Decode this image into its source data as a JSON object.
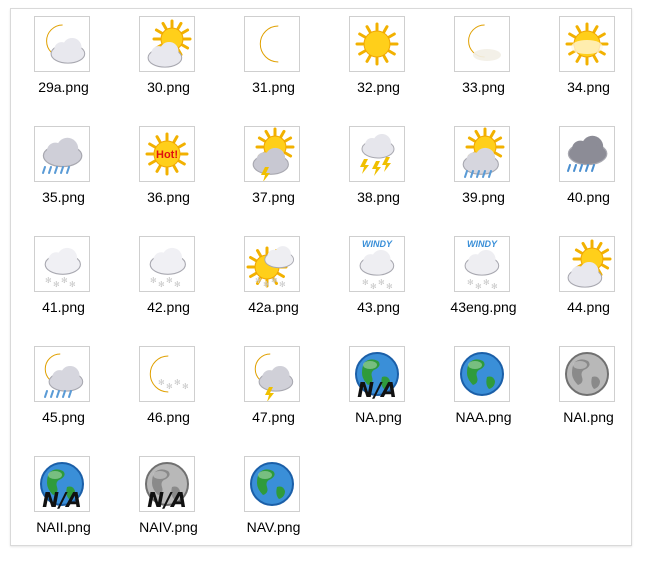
{
  "files": [
    {
      "name": "29a.png",
      "icon": "moon-cloud-icon"
    },
    {
      "name": "30.png",
      "icon": "sun-cloud-icon"
    },
    {
      "name": "31.png",
      "icon": "moon-icon"
    },
    {
      "name": "32.png",
      "icon": "sun-icon"
    },
    {
      "name": "33.png",
      "icon": "moon-fog-icon"
    },
    {
      "name": "34.png",
      "icon": "sun-haze-icon"
    },
    {
      "name": "35.png",
      "icon": "cloud-rain-snow-icon"
    },
    {
      "name": "36.png",
      "icon": "sun-hot-icon",
      "text": "Hot!"
    },
    {
      "name": "37.png",
      "icon": "sun-storm-cloud-icon"
    },
    {
      "name": "38.png",
      "icon": "cloud-lightning-icon"
    },
    {
      "name": "39.png",
      "icon": "sun-rain-cloud-icon"
    },
    {
      "name": "40.png",
      "icon": "dark-cloud-rain-icon"
    },
    {
      "name": "41.png",
      "icon": "cloud-snow-icon"
    },
    {
      "name": "42.png",
      "icon": "cloud-snowflakes-icon"
    },
    {
      "name": "42a.png",
      "icon": "sun-snow-cloud-icon"
    },
    {
      "name": "43.png",
      "icon": "windy-cloud-icon",
      "text": "WINDY"
    },
    {
      "name": "43eng.png",
      "icon": "windy-cloud-icon",
      "text": "WINDY"
    },
    {
      "name": "44.png",
      "icon": "sun-cloud-icon"
    },
    {
      "name": "45.png",
      "icon": "moon-cloud-rain-icon"
    },
    {
      "name": "46.png",
      "icon": "moon-snow-icon"
    },
    {
      "name": "47.png",
      "icon": "moon-storm-cloud-icon"
    },
    {
      "name": "NA.png",
      "icon": "globe-na-icon",
      "text": "N/A"
    },
    {
      "name": "NAA.png",
      "icon": "globe-icon"
    },
    {
      "name": "NAI.png",
      "icon": "gray-globe-icon"
    },
    {
      "name": "NAII.png",
      "icon": "globe-na-icon",
      "text": "N/A"
    },
    {
      "name": "NAIV.png",
      "icon": "gray-globe-na-icon",
      "text": "N/A"
    },
    {
      "name": "NAV.png",
      "icon": "globe-icon"
    }
  ]
}
